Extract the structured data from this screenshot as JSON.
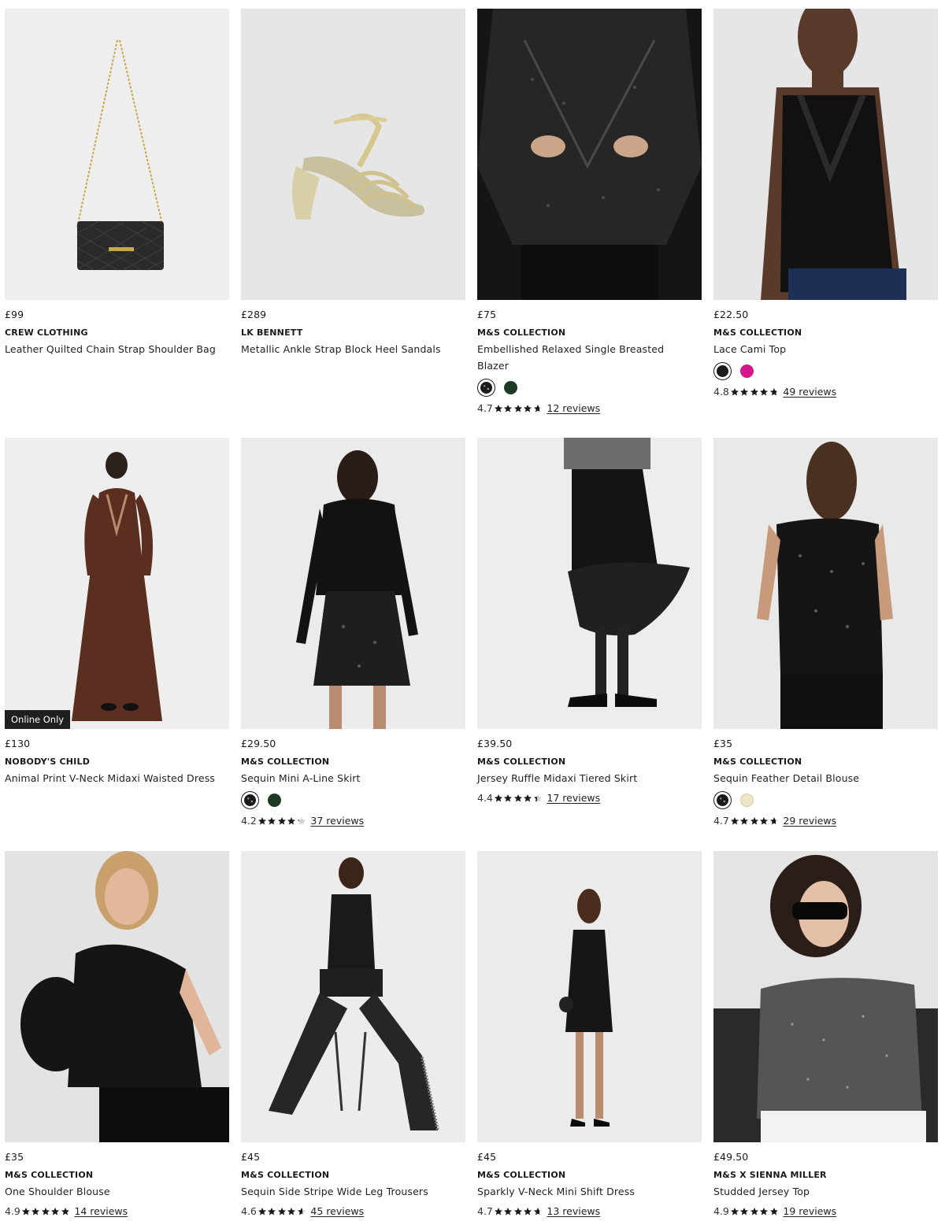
{
  "products": [
    {
      "price": "£99",
      "brand": "CREW CLOTHING",
      "title": "Leather Quilted Chain Strap Shoulder Bag",
      "image_icon": "shoulder-bag-image",
      "bg": "#eeeeee"
    },
    {
      "price": "£289",
      "brand": "LK BENNETT",
      "title": "Metallic Ankle Strap Block Heel Sandals",
      "image_icon": "sandal-image",
      "bg": "#e6e6e6"
    },
    {
      "price": "£75",
      "brand": "M&S COLLECTION",
      "title": "Embellished Relaxed Single Breasted Blazer",
      "image_icon": "sequin-blazer-image",
      "bg": "#e9e9e9",
      "swatches": [
        {
          "color": "#1a1a1a",
          "selected": true,
          "pattern": "sequin"
        },
        {
          "color": "#1e3a24",
          "selected": false
        }
      ],
      "rating": {
        "score": "4.7",
        "stars": 4.7,
        "reviews": "12 reviews"
      }
    },
    {
      "price": "£22.50",
      "brand": "M&S COLLECTION",
      "title": "Lace Cami Top",
      "image_icon": "lace-cami-image",
      "bg": "#e8e8e8",
      "swatches": [
        {
          "color": "#1c1c1c",
          "selected": true
        },
        {
          "color": "#d4168f",
          "selected": false
        }
      ],
      "rating": {
        "score": "4.8",
        "stars": 4.8,
        "reviews": "49 reviews"
      }
    },
    {
      "price": "£130",
      "brand": "NOBODY'S CHILD",
      "title": "Animal Print V-Neck Midaxi Waisted Dress",
      "image_icon": "midaxi-dress-image",
      "bg": "#eeeeee",
      "badge": "Online Only"
    },
    {
      "price": "£29.50",
      "brand": "M&S COLLECTION",
      "title": "Sequin Mini A-Line Skirt",
      "image_icon": "sequin-skirt-image",
      "bg": "#ebebeb",
      "swatches": [
        {
          "color": "#1a1a1a",
          "selected": true,
          "pattern": "sequin"
        },
        {
          "color": "#1f3a24",
          "selected": false
        }
      ],
      "rating": {
        "score": "4.2",
        "stars": 4.2,
        "reviews": "37 reviews"
      }
    },
    {
      "price": "£39.50",
      "brand": "M&S COLLECTION",
      "title": "Jersey Ruffle Midaxi Tiered Skirt",
      "image_icon": "ruffle-skirt-image",
      "bg": "#ededed",
      "rating": {
        "score": "4.4",
        "stars": 4.4,
        "reviews": "17 reviews"
      }
    },
    {
      "price": "£35",
      "brand": "M&S COLLECTION",
      "title": "Sequin Feather Detail Blouse",
      "image_icon": "sequin-blouse-image",
      "bg": "#e9e9e9",
      "swatches": [
        {
          "color": "#1a1a1a",
          "selected": true,
          "pattern": "sequin"
        },
        {
          "color": "#efe3c8",
          "selected": false
        }
      ],
      "rating": {
        "score": "4.7",
        "stars": 4.7,
        "reviews": "29 reviews"
      }
    },
    {
      "price": "£35",
      "brand": "M&S COLLECTION",
      "title": "One Shoulder Blouse",
      "image_icon": "one-shoulder-blouse-image",
      "bg": "#e3e3e3",
      "rating": {
        "score": "4.9",
        "stars": 4.9,
        "reviews": "14 reviews"
      }
    },
    {
      "price": "£45",
      "brand": "M&S COLLECTION",
      "title": "Sequin Side Stripe Wide Leg Trousers",
      "image_icon": "wide-leg-trousers-image",
      "bg": "#ececec",
      "rating": {
        "score": "4.6",
        "stars": 4.6,
        "reviews": "45 reviews"
      }
    },
    {
      "price": "£45",
      "brand": "M&S COLLECTION",
      "title": "Sparkly V-Neck Mini Shift Dress",
      "image_icon": "shift-dress-image",
      "bg": "#ebebeb",
      "rating": {
        "score": "4.7",
        "stars": 4.7,
        "reviews": "13 reviews"
      }
    },
    {
      "price": "£49.50",
      "brand": "M&S X SIENNA MILLER",
      "title": "Studded Jersey Top",
      "image_icon": "studded-top-image",
      "bg": "#e4e4e4",
      "rating": {
        "score": "4.9",
        "stars": 4.9,
        "reviews": "19 reviews"
      }
    }
  ]
}
